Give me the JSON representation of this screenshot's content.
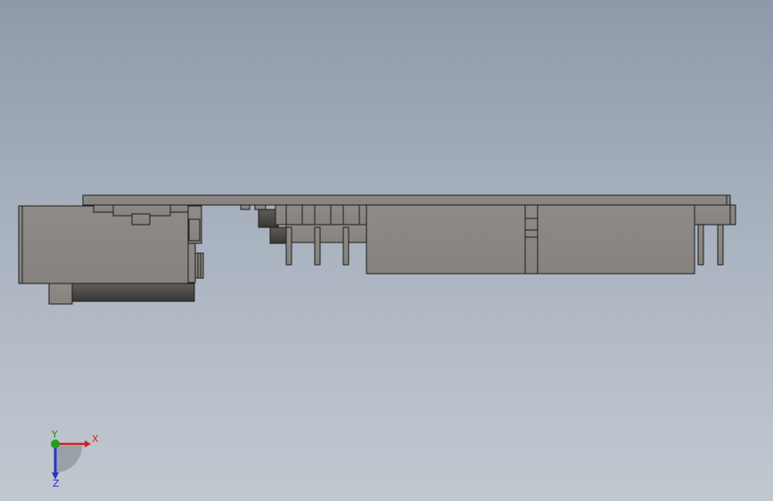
{
  "viewport": {
    "background_top": "#8e9aaa",
    "background_bottom": "#c2c8d0",
    "part_color": "#8a8782",
    "edge_color": "#1e1e1e"
  },
  "triad": {
    "x_label": "X",
    "y_label": "Y",
    "z_label": "Z",
    "x_color": "#d0201a",
    "y_color": "#1ea01e",
    "z_color": "#2436c8"
  }
}
